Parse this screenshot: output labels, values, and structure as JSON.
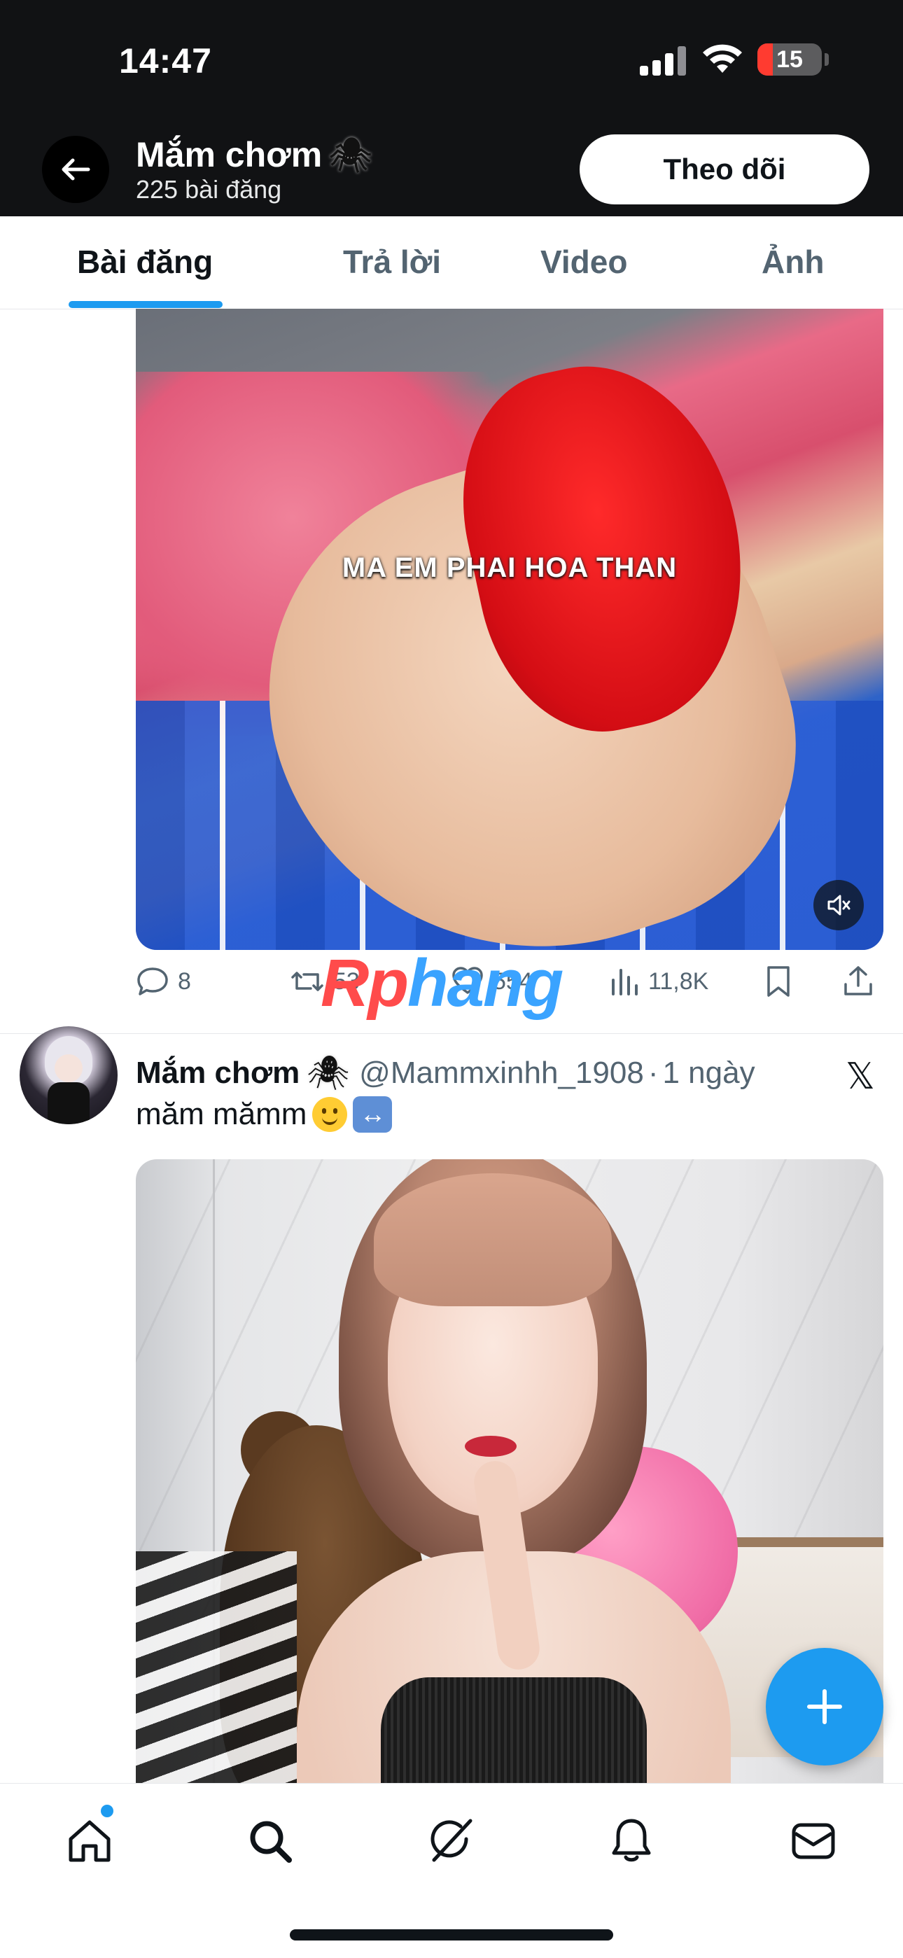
{
  "status_bar": {
    "time": "14:47",
    "battery": "15",
    "battery_color": "#ff3b30"
  },
  "header": {
    "name": "Mắm chơm",
    "name_emoji": "🕷",
    "post_count": "225 bài đăng",
    "follow_label": "Theo dõi",
    "back_icon": "arrow-left-icon"
  },
  "tabs": [
    {
      "label": "Bài đăng",
      "active": true
    },
    {
      "label": "Trả lời",
      "active": false
    },
    {
      "label": "Video",
      "active": false
    },
    {
      "label": "Ảnh",
      "active": false
    }
  ],
  "post1": {
    "video_caption": "MA EM PHAI HOA THAN",
    "mute_icon": "speaker-muted-icon",
    "replies": "8",
    "reposts": "53",
    "likes": "554",
    "views": "11,8K",
    "bookmark_icon": "bookmark-icon",
    "share_icon": "share-icon"
  },
  "watermark": {
    "part1": "Rp",
    "part2": "hang"
  },
  "post2": {
    "name": "Mắm chơm",
    "name_emoji": "🕷",
    "handle": "@Mammxinhh_1908",
    "separator": "·",
    "time": "1 ngày",
    "text": "măm mămm",
    "emoji1": "slightly-smiling-face-emoji",
    "emoji2": "left-right-arrow-emoji",
    "emoji2_glyph": "↔",
    "platform_icon": "x-logo-icon",
    "platform_glyph": "𝕏"
  },
  "fab": {
    "icon": "plus-icon"
  },
  "bottom_nav": {
    "items": [
      "home-icon",
      "search-icon",
      "grok-icon",
      "notifications-bell-icon",
      "messages-envelope-icon"
    ],
    "accent": "#1d9bf0"
  }
}
